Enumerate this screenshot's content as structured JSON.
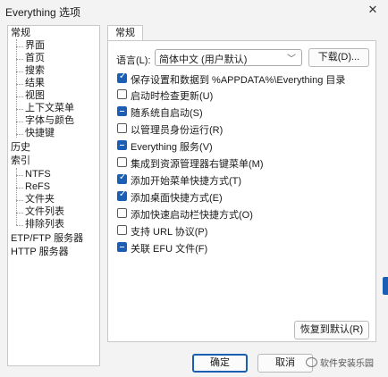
{
  "window": {
    "title": "Everything 选项",
    "close_icon": "close-icon"
  },
  "sidebar": {
    "items": [
      {
        "label": "常规",
        "level": 0
      },
      {
        "label": "界面",
        "level": 1
      },
      {
        "label": "首页",
        "level": 1
      },
      {
        "label": "搜索",
        "level": 1
      },
      {
        "label": "结果",
        "level": 1
      },
      {
        "label": "视图",
        "level": 1
      },
      {
        "label": "上下文菜单",
        "level": 1
      },
      {
        "label": "字体与颜色",
        "level": 1
      },
      {
        "label": "快捷键",
        "level": 1
      },
      {
        "label": "历史",
        "level": 0
      },
      {
        "label": "索引",
        "level": 0
      },
      {
        "label": "NTFS",
        "level": 1
      },
      {
        "label": "ReFS",
        "level": 1
      },
      {
        "label": "文件夹",
        "level": 1
      },
      {
        "label": "文件列表",
        "level": 1
      },
      {
        "label": "排除列表",
        "level": 1
      },
      {
        "label": "ETP/FTP 服务器",
        "level": 0
      },
      {
        "label": "HTTP 服务器",
        "level": 0
      }
    ]
  },
  "tab": {
    "label": "常规"
  },
  "language": {
    "label": "语言(L):",
    "selected": "简体中文 (用户默认)",
    "download_button": "下载(D)..."
  },
  "options": [
    {
      "label": "保存设置和数据到 %APPDATA%\\Everything 目录",
      "state": "checked"
    },
    {
      "label": "启动时检查更新(U)",
      "state": "unchecked"
    },
    {
      "label": "随系统自启动(S)",
      "state": "partial"
    },
    {
      "label": "以管理员身份运行(R)",
      "state": "unchecked"
    },
    {
      "label": "Everything 服务(V)",
      "state": "partial"
    },
    {
      "label": "集成到资源管理器右键菜单(M)",
      "state": "unchecked"
    },
    {
      "label": "添加开始菜单快捷方式(T)",
      "state": "checked"
    },
    {
      "label": "添加桌面快捷方式(E)",
      "state": "checked"
    },
    {
      "label": "添加快速启动栏快捷方式(O)",
      "state": "unchecked"
    },
    {
      "label": "支持 URL 协议(P)",
      "state": "unchecked"
    },
    {
      "label": "关联 EFU 文件(F)",
      "state": "partial"
    }
  ],
  "footer": {
    "restore_default": "恢复到默认(R)",
    "ok": "确定",
    "cancel": "取消",
    "watermark": "软件安装乐园"
  },
  "colors": {
    "accent": "#1a5fb4",
    "window_bg": "#f3f3f3",
    "panel_bg": "#ffffff"
  }
}
